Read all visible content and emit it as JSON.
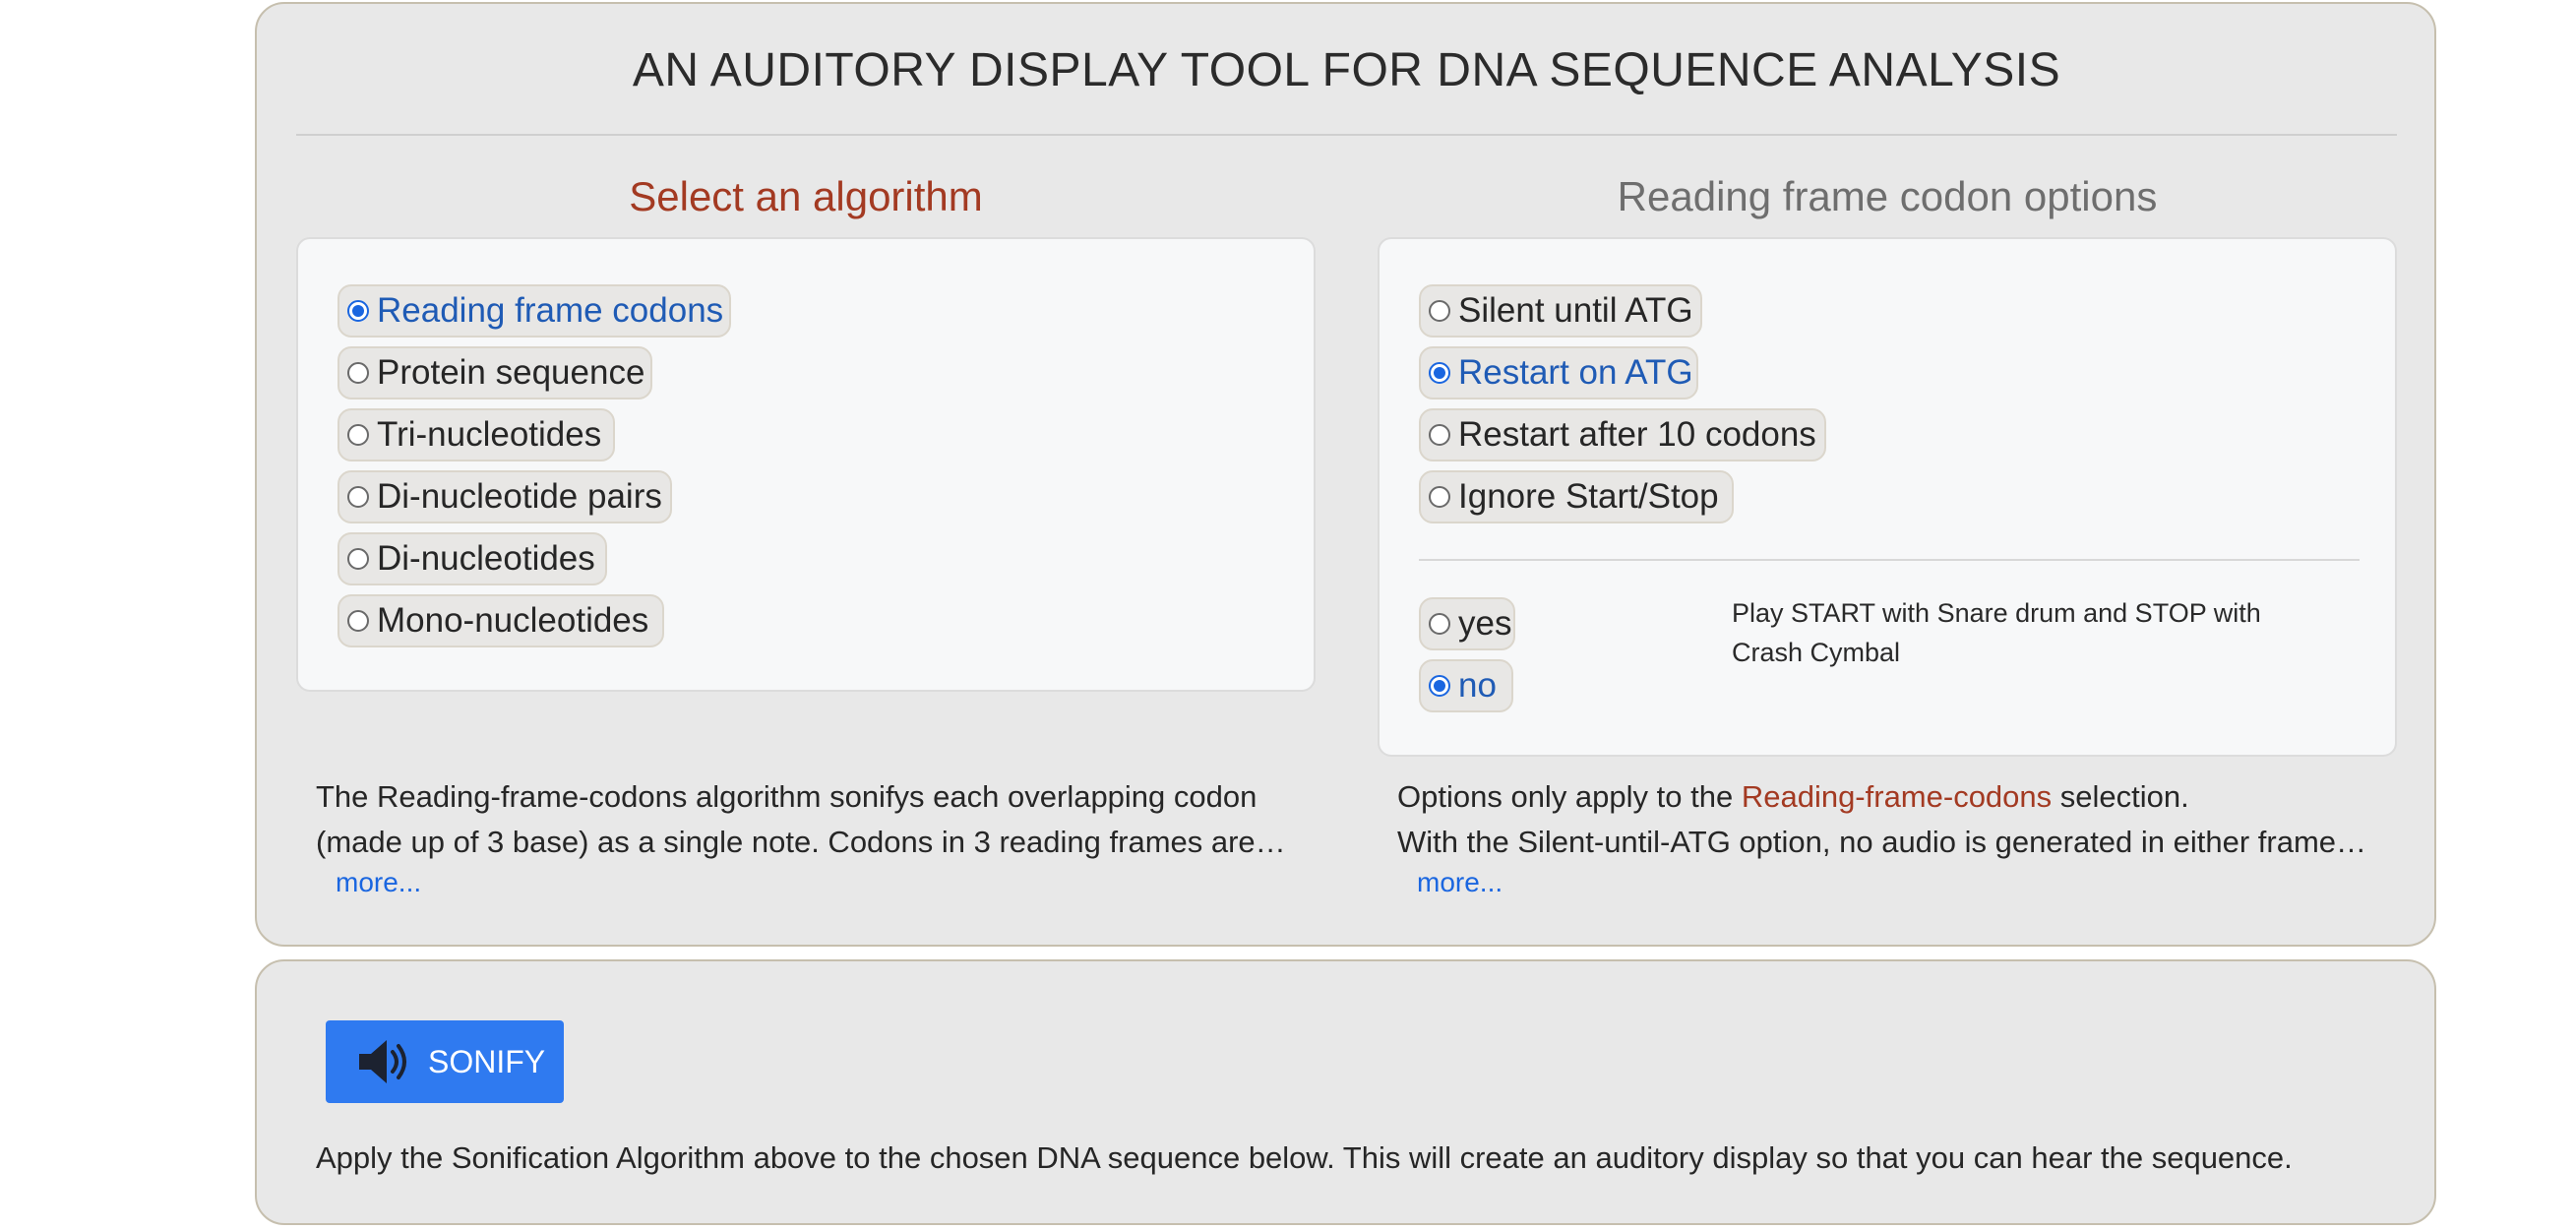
{
  "title": "AN AUDITORY DISPLAY TOOL FOR DNA SEQUENCE ANALYSIS",
  "algorithm": {
    "heading": "Select an algorithm",
    "options": [
      {
        "label": "Reading frame codons",
        "selected": true
      },
      {
        "label": "Protein sequence",
        "selected": false
      },
      {
        "label": "Tri-nucleotides",
        "selected": false
      },
      {
        "label": "Di-nucleotide pairs",
        "selected": false
      },
      {
        "label": "Di-nucleotides",
        "selected": false
      },
      {
        "label": "Mono-nucleotides",
        "selected": false
      }
    ],
    "description_line1": "The Reading-frame-codons algorithm sonifys each overlapping codon",
    "description_line2": "(made up of 3 base) as a single note. Codons in 3 reading frames are…",
    "more": "more..."
  },
  "options": {
    "heading": "Reading frame codon options",
    "items": [
      {
        "label": "Silent until ATG",
        "selected": false
      },
      {
        "label": "Restart on ATG",
        "selected": true
      },
      {
        "label": "Restart after 10 codons",
        "selected": false
      },
      {
        "label": "Ignore Start/Stop",
        "selected": false
      }
    ],
    "drum": {
      "yes": "yes",
      "no": "no",
      "selected": "no",
      "note": "Play START with Snare drum and STOP with Crash Cymbal"
    },
    "description_prefix": "Options only apply to the ",
    "description_highlight": "Reading-frame-codons",
    "description_suffix": " selection.",
    "description_line2": "With the Silent-until-ATG option, no audio is generated in either frame…",
    "more": "more..."
  },
  "sonify": {
    "button_label": "SONIFY",
    "button_icon": "speaker-icon",
    "apply_text": "Apply the Sonification Algorithm above to the chosen DNA sequence below. This will create an auditory display so that you can hear the sequence."
  },
  "colors": {
    "selected_text": "#1f5bb5",
    "heading_accent": "#a33a22",
    "link": "#1a66e0",
    "button": "#2f7af0"
  }
}
